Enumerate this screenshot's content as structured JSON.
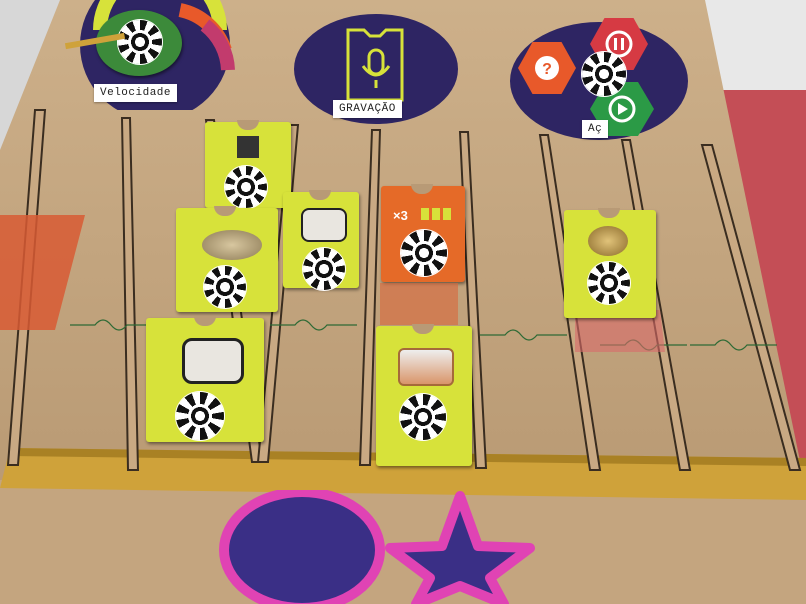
{
  "colors": {
    "board": "#c8ab85",
    "panel_navy": "#2e2563",
    "tile_yellow": "#d7e23a",
    "tile_orange": "#e56a28",
    "rail_yellow": "#cfa23a",
    "pink_outline": "#e043b4",
    "shape_fill": "#3a2f86"
  },
  "labels": {
    "speed": "Velocidade",
    "recording": "GRAVAÇÃO",
    "actions": "Aç"
  },
  "repeat_tile": {
    "multiplier": "×3"
  },
  "icons": {
    "speed_dial": "speedometer-gauge",
    "recording": "microphone-icon",
    "help": "question-icon",
    "pause": "pause-icon",
    "play": "play-icon"
  },
  "instruments": [
    "bass-drum",
    "cymbal",
    "bass-drum",
    "snare-drum",
    "crash-cymbal",
    "hi-hat"
  ]
}
